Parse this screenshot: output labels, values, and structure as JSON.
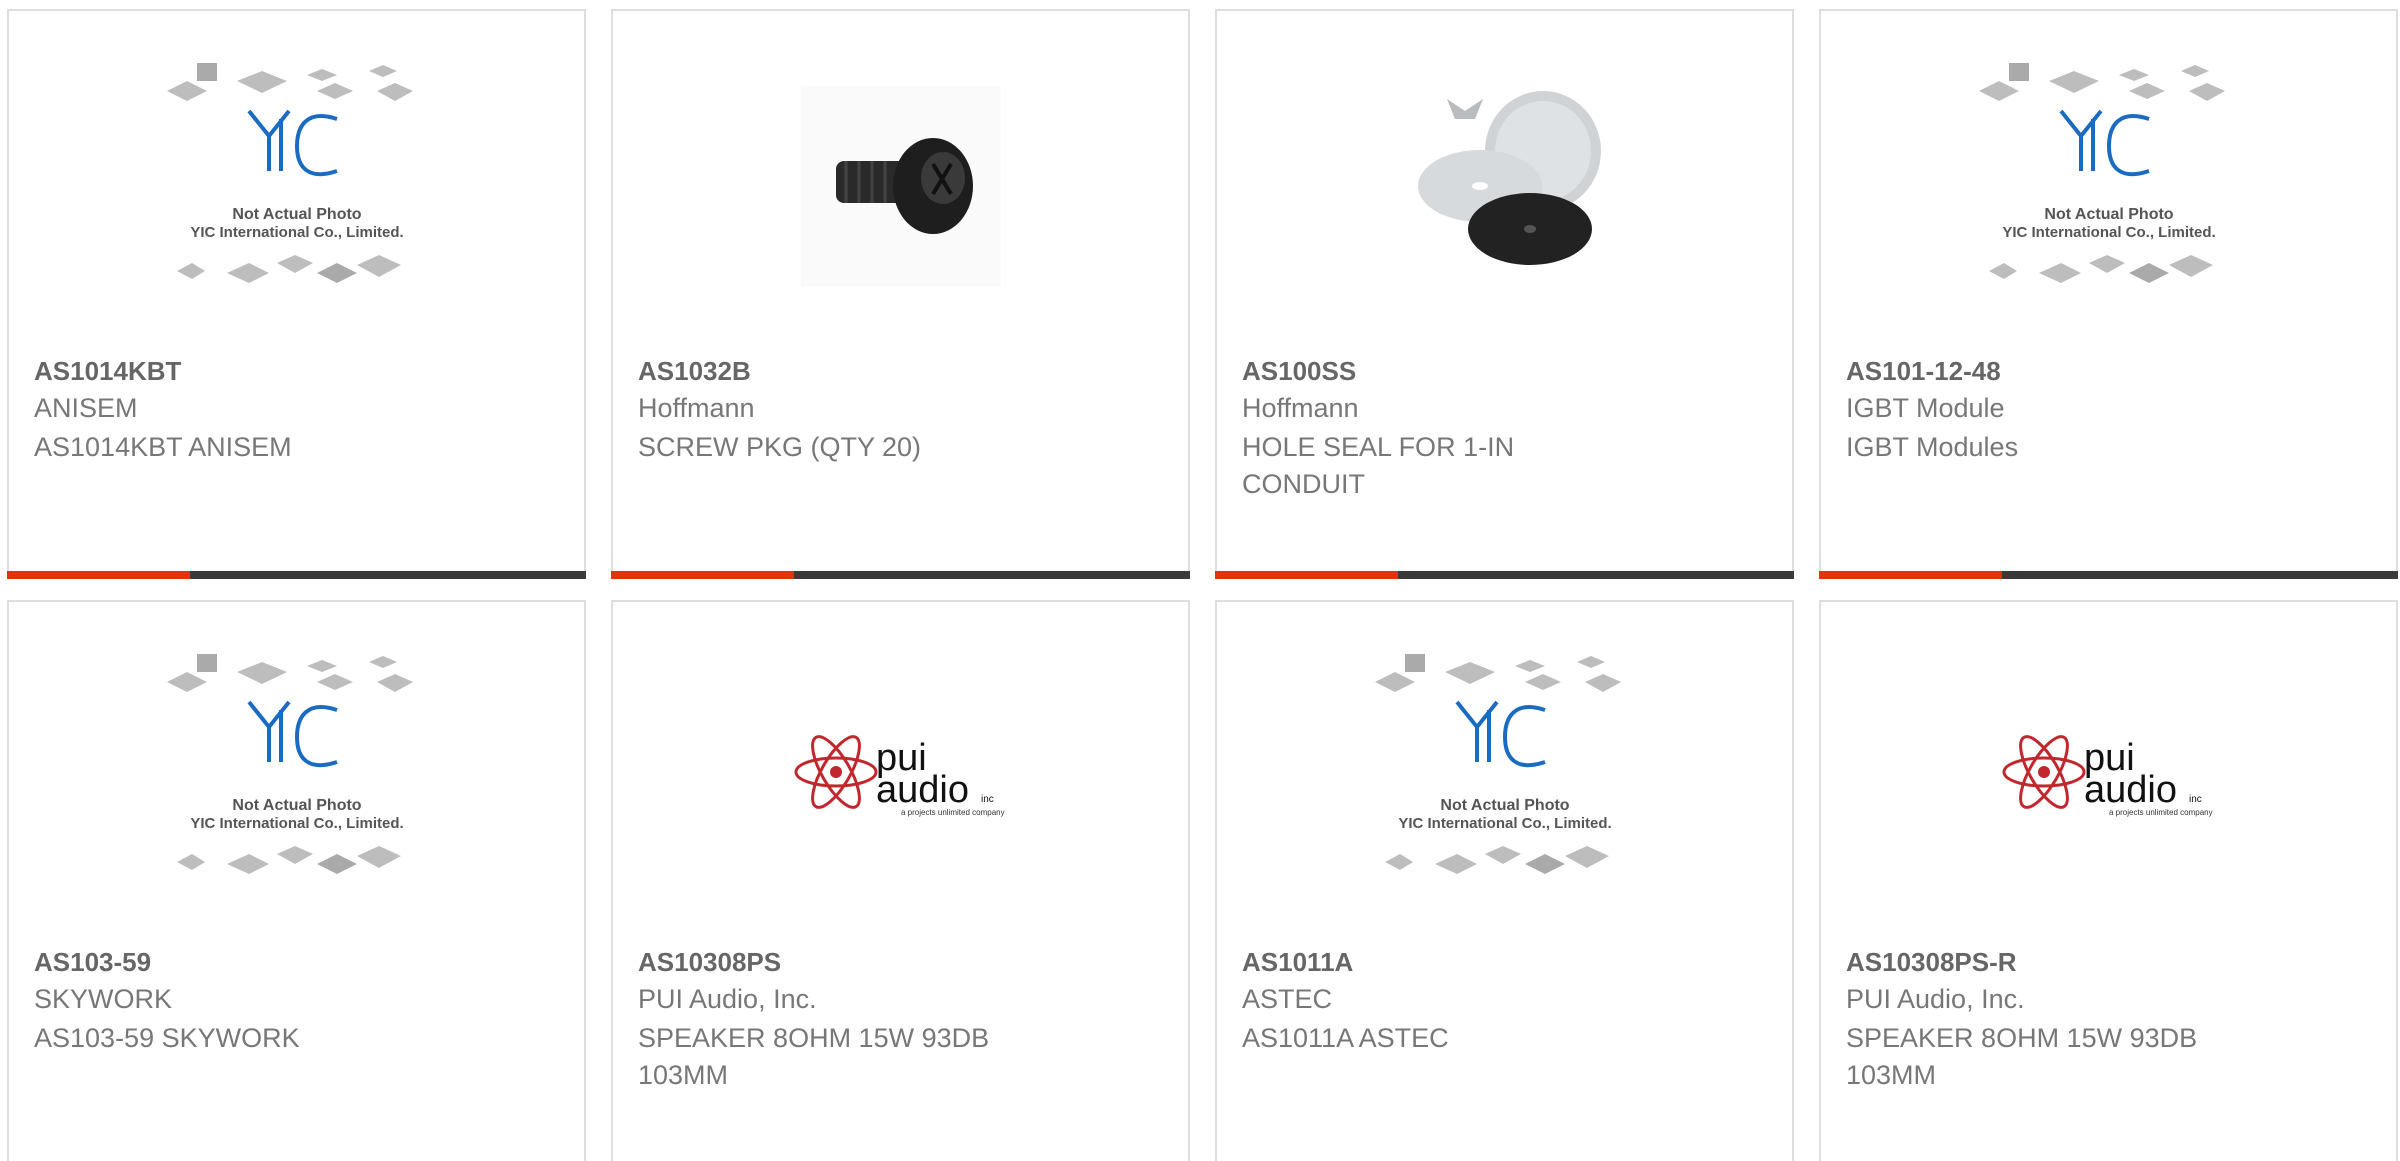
{
  "products": [
    {
      "part": "AS1014KBT",
      "maker": "ANISEM",
      "description": "AS1014KBT ANISEM",
      "image": "yic-placeholder"
    },
    {
      "part": "AS1032B",
      "maker": "Hoffmann",
      "description": "SCREW PKG (QTY 20)",
      "image": "screw"
    },
    {
      "part": "AS100SS",
      "maker": "Hoffmann",
      "description": "HOLE SEAL FOR 1-IN CONDUIT",
      "image": "hole-seal"
    },
    {
      "part": "AS101-12-48",
      "maker": "IGBT Module",
      "description": "IGBT Modules",
      "image": "yic-placeholder"
    },
    {
      "part": "AS103-59",
      "maker": "SKYWORK",
      "description": "AS103-59 SKYWORK",
      "image": "yic-placeholder"
    },
    {
      "part": "AS10308PS",
      "maker": "PUI Audio, Inc.",
      "description": "SPEAKER 8OHM 15W 93DB 103MM",
      "image": "pui-audio-logo"
    },
    {
      "part": "AS1011A",
      "maker": "ASTEC",
      "description": "AS1011A ASTEC",
      "image": "yic-placeholder"
    },
    {
      "part": "AS10308PS-R",
      "maker": "PUI Audio, Inc.",
      "description": "SPEAKER 8OHM 15W 93DB 103MM",
      "image": "pui-audio-logo"
    }
  ],
  "placeholder": {
    "logo": "YIC",
    "line1": "Not Actual Photo",
    "line2": "YIC International Co., Limited."
  },
  "pui_logo": {
    "top": "pui",
    "bottom": "audio",
    "suffix": "inc",
    "tagline": "a projects unlimited company"
  },
  "colors": {
    "accent": "#e2330d",
    "bar": "#3a3a3a",
    "yic_blue": "#1b6cc0",
    "pui_red": "#c0282d"
  }
}
